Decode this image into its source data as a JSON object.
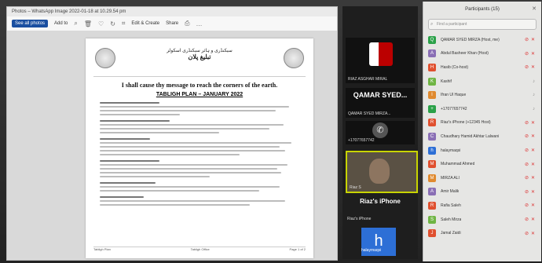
{
  "viewer": {
    "title": "Photos – WhatsApp Image 2022-01-18 at 10.29.54 pm",
    "toolbar": {
      "see_all": "See all photos",
      "add_to": "Add to",
      "edit_create": "Edit & Create",
      "share": "Share"
    },
    "document": {
      "urdu_line1": "سیکنڈری و ہائر سیکنڈری اسکولز",
      "urdu_line2": "تبلیغ پلان",
      "quote": "I shall cause thy message to reach the corners of the earth.",
      "plan_title": "TABLIGH PLAN – JANUARY 2022",
      "footer_left": "Tabligh Plan",
      "footer_mid": "Tabligh Office",
      "footer_right": "Page 1 of 2"
    }
  },
  "video": {
    "flag_tile_caption": "RIAZ ASGHAR MIRAL",
    "qamar_name": "QAMAR SYED...",
    "qamar_caption": "QAMAR SYED MIRZA...",
    "phone_caption": "+17077657742",
    "cam_caption": "Riaz S",
    "riaz_name": "Riaz's iPhone",
    "riaz_caption": "Riaz's iPhone",
    "h_letter": "h",
    "h_caption": "halaymaqsi"
  },
  "participants": {
    "title": "Participants (15)",
    "search_placeholder": "Find a participant",
    "rows": [
      {
        "initial": "Q",
        "color": "#2aa148",
        "name": "QAMAR SYED MIRZA (Host, me)",
        "status": "mute"
      },
      {
        "initial": "A",
        "color": "#8a6fb5",
        "name": "Abdul Basheer Khan (Host)",
        "status": "mute"
      },
      {
        "initial": "H",
        "color": "#e0502f",
        "name": "Hasib (Co-host)",
        "status": "mute"
      },
      {
        "initial": "K",
        "color": "#6fb544",
        "name": "Kashif",
        "status": "ok"
      },
      {
        "initial": "I",
        "color": "#e08a2f",
        "name": "Ifran Ul Haque",
        "status": "ok"
      },
      {
        "initial": "+",
        "color": "#2aa148",
        "name": "+17077657742",
        "status": "ok"
      },
      {
        "initial": "R",
        "color": "#e0502f",
        "name": "Riaz's iPhone (+12345 Host)",
        "status": "mute"
      },
      {
        "initial": "C",
        "color": "#8a6fb5",
        "name": "Chaudhary Hamid Akhtar Lalwani",
        "status": "mute"
      },
      {
        "initial": "h",
        "color": "#2d6fd6",
        "name": "halaymaqsi",
        "status": "mute"
      },
      {
        "initial": "M",
        "color": "#e0502f",
        "name": "Muhammad Ahmed",
        "status": "mute"
      },
      {
        "initial": "M",
        "color": "#e08a2f",
        "name": "MIRZA ALI",
        "status": "mute"
      },
      {
        "initial": "A",
        "color": "#8a6fb5",
        "name": "Amir Malik",
        "status": "mute"
      },
      {
        "initial": "R",
        "color": "#e0502f",
        "name": "Rafia Saleh",
        "status": "mute"
      },
      {
        "initial": "S",
        "color": "#6fb544",
        "name": "Saleh Mirza",
        "status": "mute"
      },
      {
        "initial": "J",
        "color": "#e0502f",
        "name": "Jamal Zaidi",
        "status": "mute"
      }
    ]
  }
}
